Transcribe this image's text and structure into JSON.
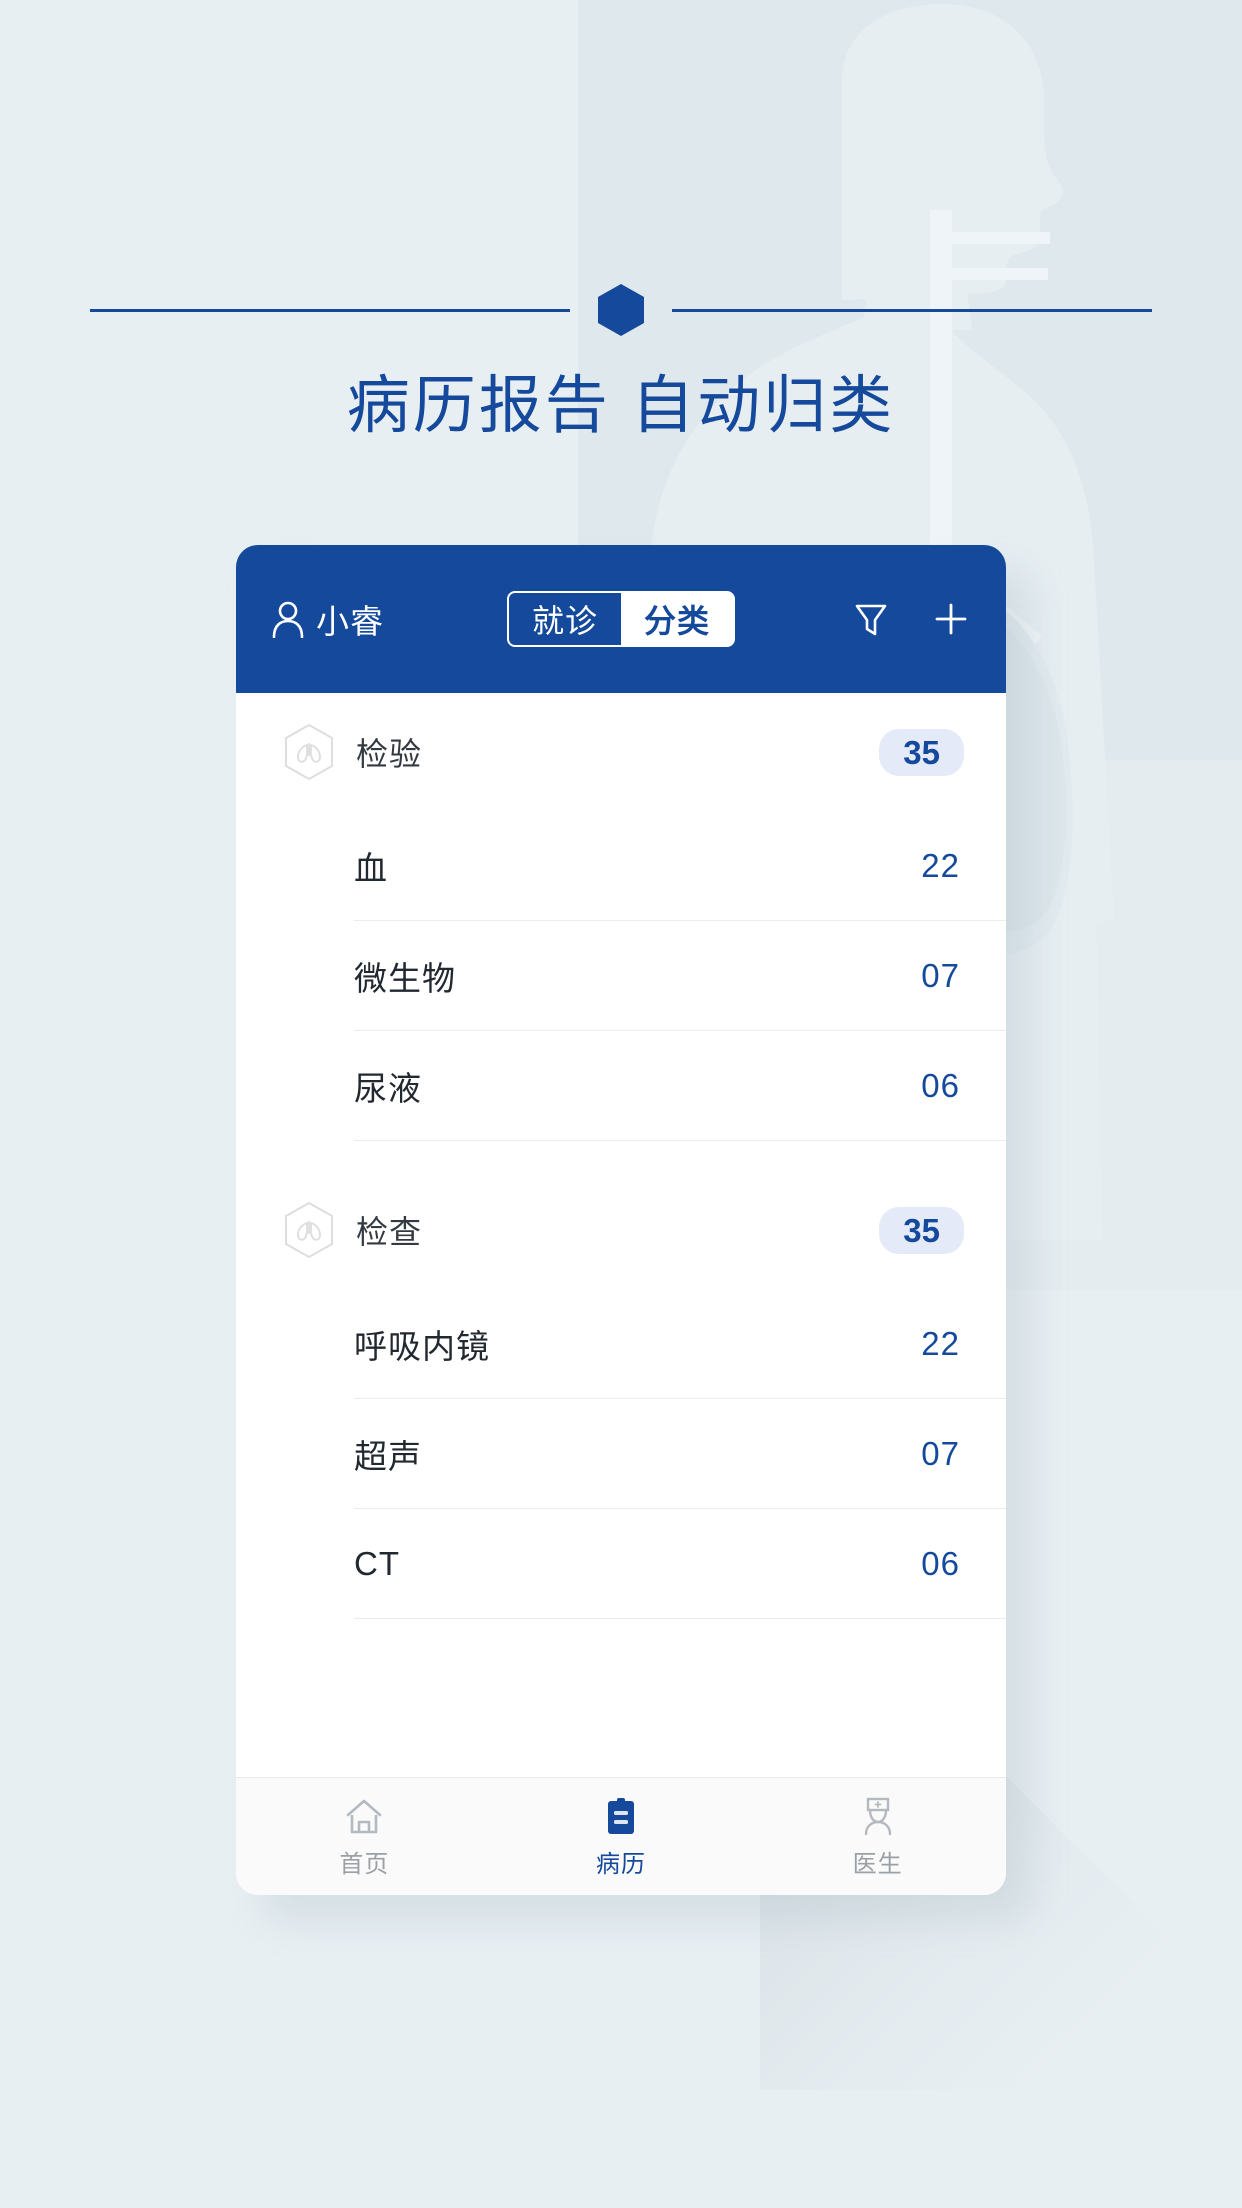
{
  "page": {
    "headline": "病历报告 自动归类",
    "background_color": "#e8eff3",
    "accent_color": "#15499c"
  },
  "app": {
    "header": {
      "user_name": "小睿",
      "user_icon": "person-icon",
      "segmented": {
        "options": [
          {
            "label": "就诊",
            "selected": true
          },
          {
            "label": "分类",
            "selected": false
          }
        ]
      },
      "filter_icon": "filter-funnel-icon",
      "add_icon": "plus-icon"
    },
    "groups": [
      {
        "icon": "lungs-hexagon-icon",
        "title": "检验",
        "count": "35",
        "items": [
          {
            "label": "血",
            "count": "22"
          },
          {
            "label": "微生物",
            "count": "07"
          },
          {
            "label": "尿液",
            "count": "06"
          }
        ]
      },
      {
        "icon": "lungs-hexagon-icon",
        "title": "检查",
        "count": "35",
        "items": [
          {
            "label": "呼吸内镜",
            "count": "22"
          },
          {
            "label": "超声",
            "count": "07"
          },
          {
            "label": "CT",
            "count": "06"
          }
        ]
      }
    ],
    "tabbar": [
      {
        "label": "首页",
        "icon": "home-icon",
        "active": false
      },
      {
        "label": "病历",
        "icon": "clipboard-icon",
        "active": true
      },
      {
        "label": "医生",
        "icon": "doctor-icon",
        "active": false
      }
    ]
  }
}
